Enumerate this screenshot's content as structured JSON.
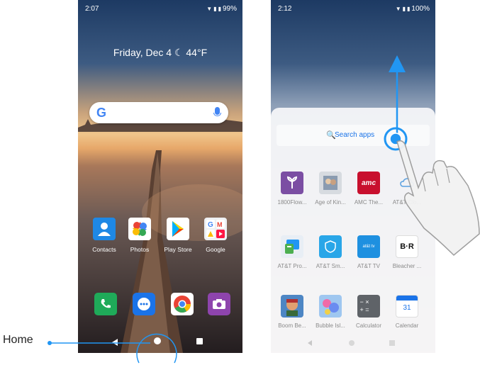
{
  "callout": {
    "home_label": "Home"
  },
  "phone_left": {
    "status": {
      "time": "2:07",
      "battery": "99%"
    },
    "widget": {
      "date_weather": "Friday, Dec 4 ☾ 44°F"
    },
    "search": {
      "logo": "G"
    },
    "apps": [
      {
        "label": "Contacts",
        "icon": "contacts-icon"
      },
      {
        "label": "Photos",
        "icon": "photos-icon"
      },
      {
        "label": "Play Store",
        "icon": "play-store-icon"
      },
      {
        "label": "Google",
        "icon": "google-folder-icon"
      }
    ],
    "dock": [
      {
        "icon": "phone-icon"
      },
      {
        "icon": "messages-icon"
      },
      {
        "icon": "chrome-icon"
      },
      {
        "icon": "camera-icon"
      }
    ]
  },
  "phone_right": {
    "status": {
      "time": "2:12",
      "battery": "100%"
    },
    "search_placeholder": "Search apps",
    "apps": [
      {
        "label": "1800Flow...",
        "icon": "1800flowers-icon"
      },
      {
        "label": "Age of Kin...",
        "icon": "age-of-kings-icon"
      },
      {
        "label": "AMC The...",
        "icon": "amc-icon",
        "badge": "amc"
      },
      {
        "label": "AT&T Clo...",
        "icon": "att-cloud-icon"
      },
      {
        "label": "AT&T Pro...",
        "icon": "att-protect-icon"
      },
      {
        "label": "AT&T Sm...",
        "icon": "att-smart-icon"
      },
      {
        "label": "AT&T TV",
        "icon": "att-tv-icon",
        "badge": "at&t tv"
      },
      {
        "label": "Bleacher ...",
        "icon": "bleacher-report-icon",
        "badge": "B·R"
      },
      {
        "label": "Boom Be...",
        "icon": "boom-beach-icon"
      },
      {
        "label": "Bubble Isl...",
        "icon": "bubble-island-icon"
      },
      {
        "label": "Calculator",
        "icon": "calculator-icon",
        "badge": "− × + ="
      },
      {
        "label": "Calendar",
        "icon": "calendar-icon",
        "badge": "31"
      }
    ]
  }
}
